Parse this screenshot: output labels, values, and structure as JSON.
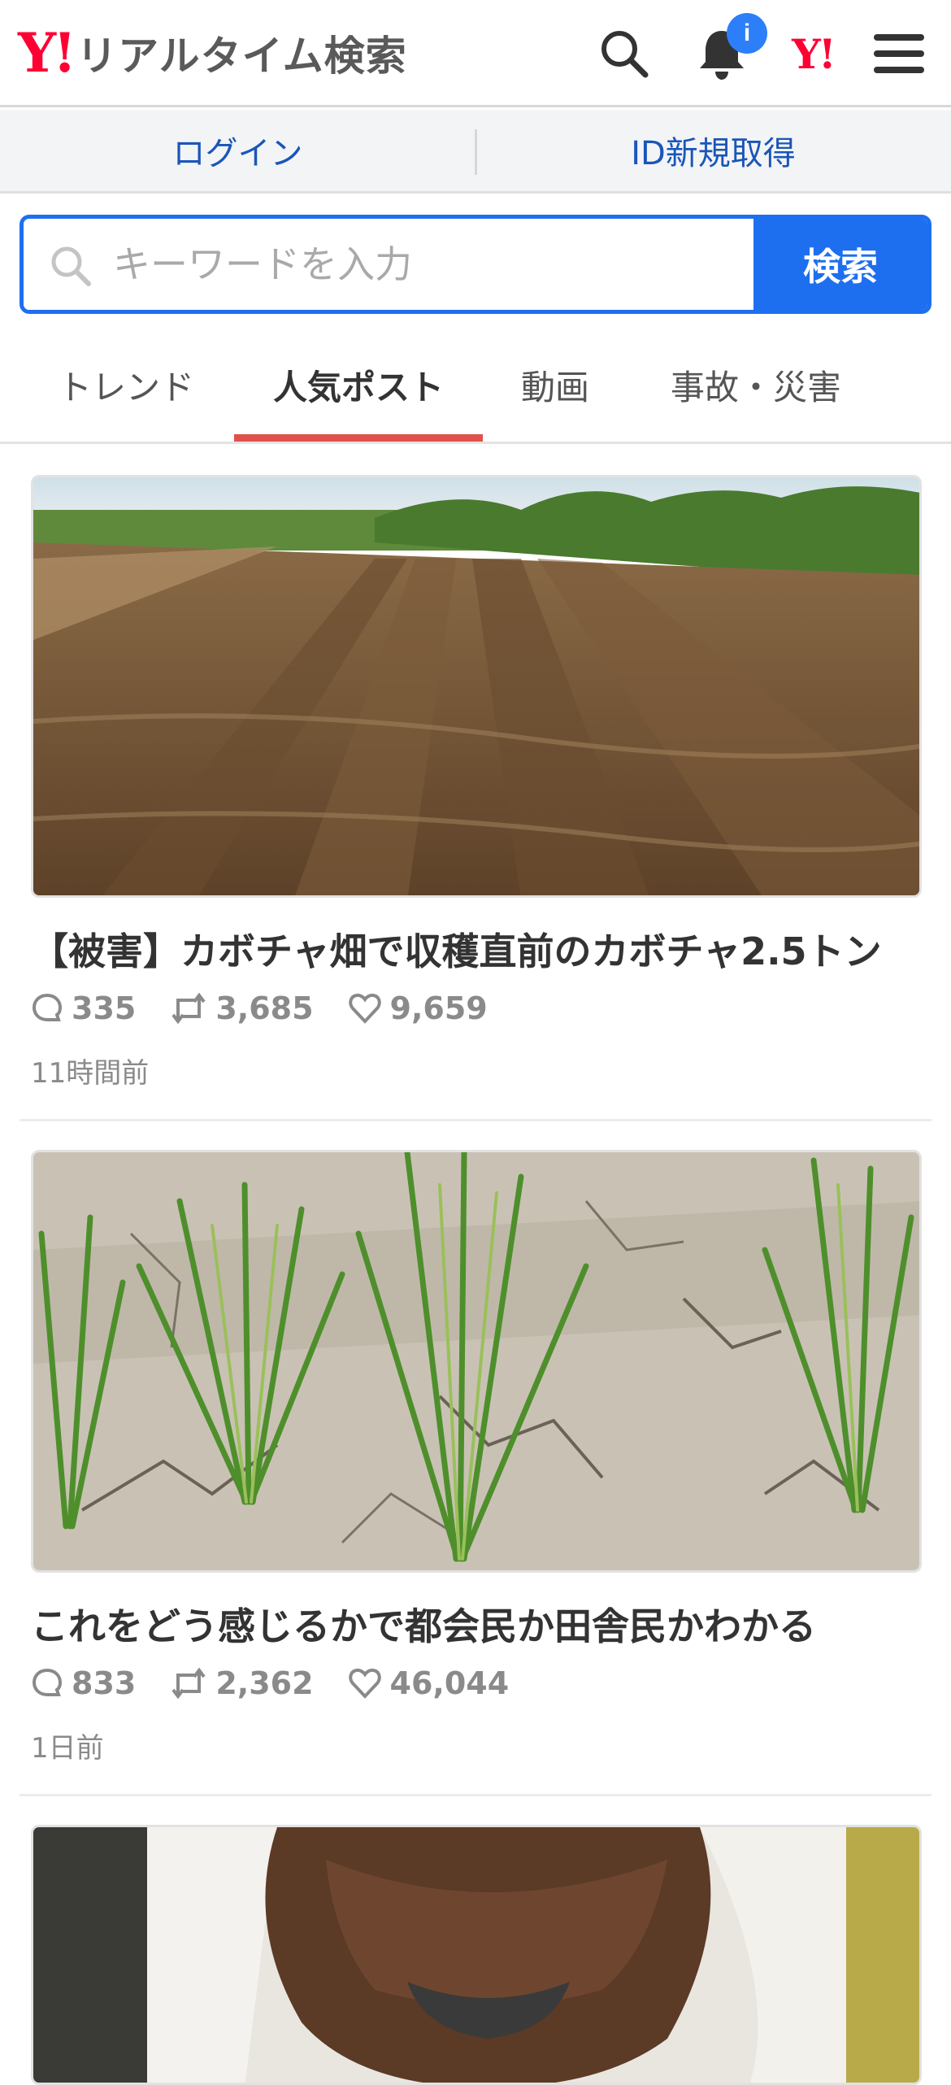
{
  "header": {
    "logo_mark": "Y!",
    "logo_text": "リアルタイム検索",
    "notification_badge": "i",
    "yjapan_mark": "Y!"
  },
  "login_bar": {
    "login_label": "ログイン",
    "register_label": "ID新規取得"
  },
  "search": {
    "placeholder": "キーワードを入力",
    "button_label": "検索"
  },
  "tabs": [
    {
      "label": "トレンド",
      "active": false
    },
    {
      "label": "人気ポスト",
      "active": true
    },
    {
      "label": "動画",
      "active": false
    },
    {
      "label": "事故・災害",
      "active": false
    }
  ],
  "posts": [
    {
      "title": "【被害】カボチャ畑で収穫直前のカボチャ2.5トン",
      "replies": "335",
      "reposts": "3,685",
      "likes": "9,659",
      "time": "11時間前",
      "image": "plowed-field"
    },
    {
      "title": "これをどう感じるかで都会民か田舎民かわかる",
      "replies": "833",
      "reposts": "2,362",
      "likes": "46,044",
      "time": "1日前",
      "image": "rice-plants-cracked-soil"
    },
    {
      "image": "person-photo"
    }
  ],
  "colors": {
    "brand_red": "#ff0033",
    "accent_blue": "#1e6ff0",
    "tab_underline": "#e0504c",
    "link_blue": "#1a56b8"
  }
}
